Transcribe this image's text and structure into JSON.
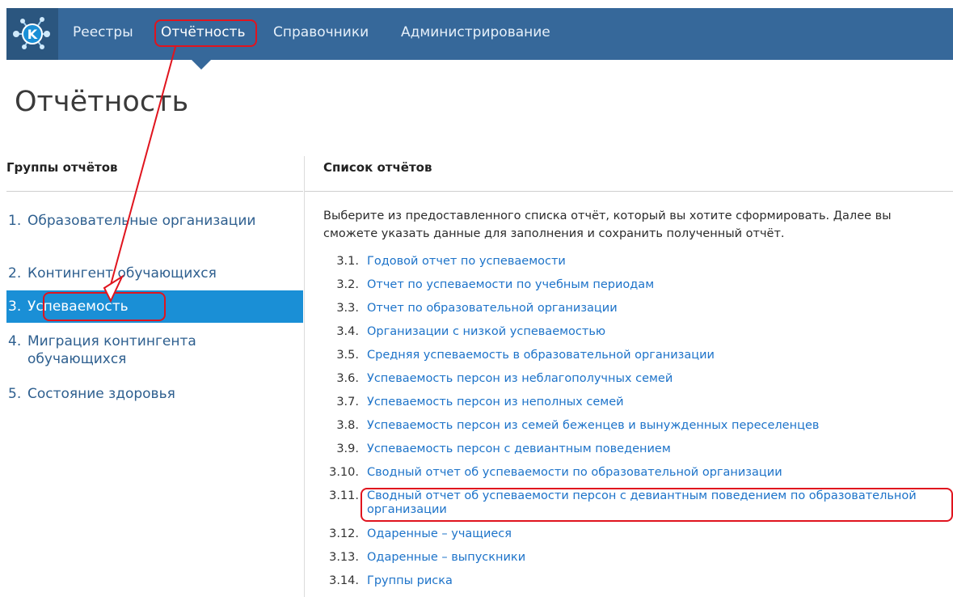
{
  "nav": {
    "items": [
      {
        "label": "Реестры"
      },
      {
        "label": "Отчётность"
      },
      {
        "label": "Справочники"
      },
      {
        "label": "Администрирование"
      }
    ]
  },
  "page": {
    "title": "Отчётность"
  },
  "groups": {
    "heading": "Группы отчётов",
    "items": [
      {
        "num": "1.",
        "label": "Образовательные организации"
      },
      {
        "num": "2.",
        "label": "Контингент обучающихся"
      },
      {
        "num": "3.",
        "label": "Успеваемость"
      },
      {
        "num": "4.",
        "label": "Миграция контингента обучающихся"
      },
      {
        "num": "5.",
        "label": "Состояние здоровья"
      }
    ]
  },
  "reports": {
    "heading": "Список отчётов",
    "intro": "Выберите из предоставленного списка отчёт, который вы хотите сформировать. Далее вы сможете указать данные для заполнения и сохранить полученный отчёт.",
    "items": [
      {
        "num": "3.1.",
        "label": "Годовой отчет по успеваемости"
      },
      {
        "num": "3.2.",
        "label": "Отчет по успеваемости по учебным периодам"
      },
      {
        "num": "3.3.",
        "label": "Отчет по образовательной организации"
      },
      {
        "num": "3.4.",
        "label": "Организации с низкой успеваемостью"
      },
      {
        "num": "3.5.",
        "label": "Средняя успеваемость в образовательной организации"
      },
      {
        "num": "3.6.",
        "label": "Успеваемость персон из неблагополучных семей"
      },
      {
        "num": "3.7.",
        "label": "Успеваемость персон из неполных семей"
      },
      {
        "num": "3.8.",
        "label": "Успеваемость персон из семей беженцев и вынужденных переселенцев"
      },
      {
        "num": "3.9.",
        "label": "Успеваемость персон с девиантным поведением"
      },
      {
        "num": "3.10.",
        "label": "Сводный отчет об успеваемости по образовательной организации"
      },
      {
        "num": "3.11.",
        "label": "Сводный отчет об успеваемости персон с девиантным поведением по образовательной",
        "label2": "организации"
      },
      {
        "num": "3.12.",
        "label": "Одаренные – учащиеся"
      },
      {
        "num": "3.13.",
        "label": "Одаренные – выпускники"
      },
      {
        "num": "3.14.",
        "label": "Группы риска"
      }
    ]
  },
  "colors": {
    "topbar": "#36689a",
    "active_group": "#1a8fd6",
    "link": "#1d73c9",
    "annotation": "#e0141e"
  },
  "icons": {
    "logo": "k-network-logo-icon"
  }
}
